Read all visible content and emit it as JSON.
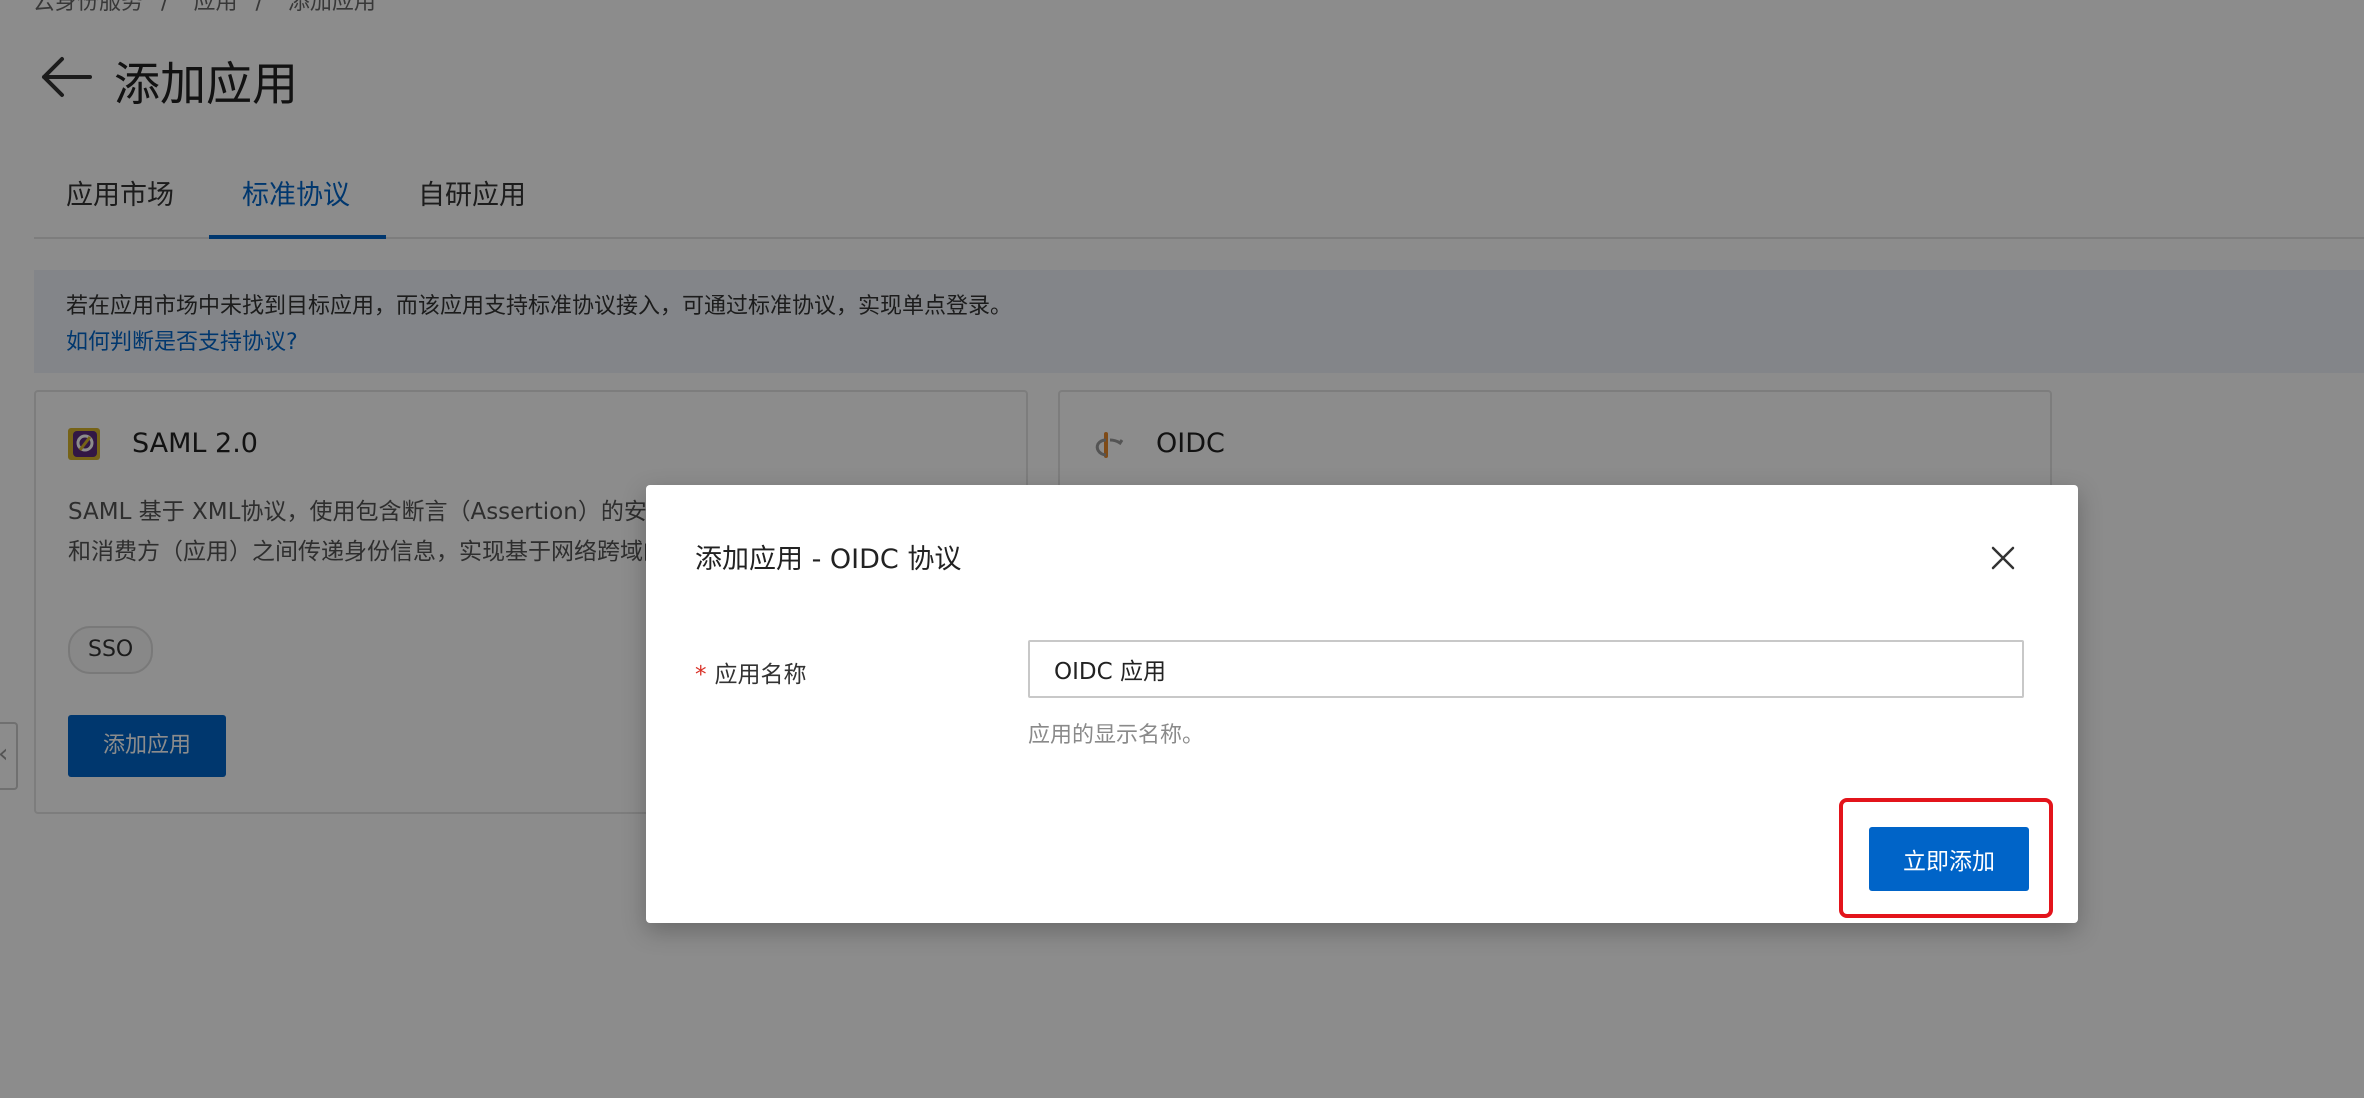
{
  "breadcrumb": [
    "云身份服务",
    "应用",
    "添加应用"
  ],
  "page_title": "添加应用",
  "tabs": [
    {
      "label": "应用市场"
    },
    {
      "label": "标准协议"
    },
    {
      "label": "自研应用"
    }
  ],
  "notice": {
    "text": "若在应用市场中未找到目标应用，而该应用支持标准协议接入，可通过标准协议，实现单点登录。",
    "link": "如何判断是否支持协议?"
  },
  "cards": [
    {
      "title": "SAML 2.0",
      "desc_line1": "SAML 基于 XML协议，使用包含断言（Assertion）的安全令牌，在授权方（IdP）",
      "desc_line2": "和消费方（应用）之间传递身份信息，实现基于网络跨域的单点登录。",
      "tag": "SSO",
      "button": "添加应用",
      "icon": "saml-logo-icon"
    },
    {
      "title": "OIDC",
      "icon": "openid-logo-icon"
    }
  ],
  "modal": {
    "title": "添加应用 - OIDC 协议",
    "field_required_mark": "*",
    "field_label": "应用名称",
    "field_value": "OIDC 应用",
    "field_help": "应用的显示名称。",
    "submit": "立即添加"
  },
  "colors": {
    "primary": "#0064c8",
    "highlight": "#e3141b",
    "mask": "rgba(0,0,0,0.45)"
  }
}
